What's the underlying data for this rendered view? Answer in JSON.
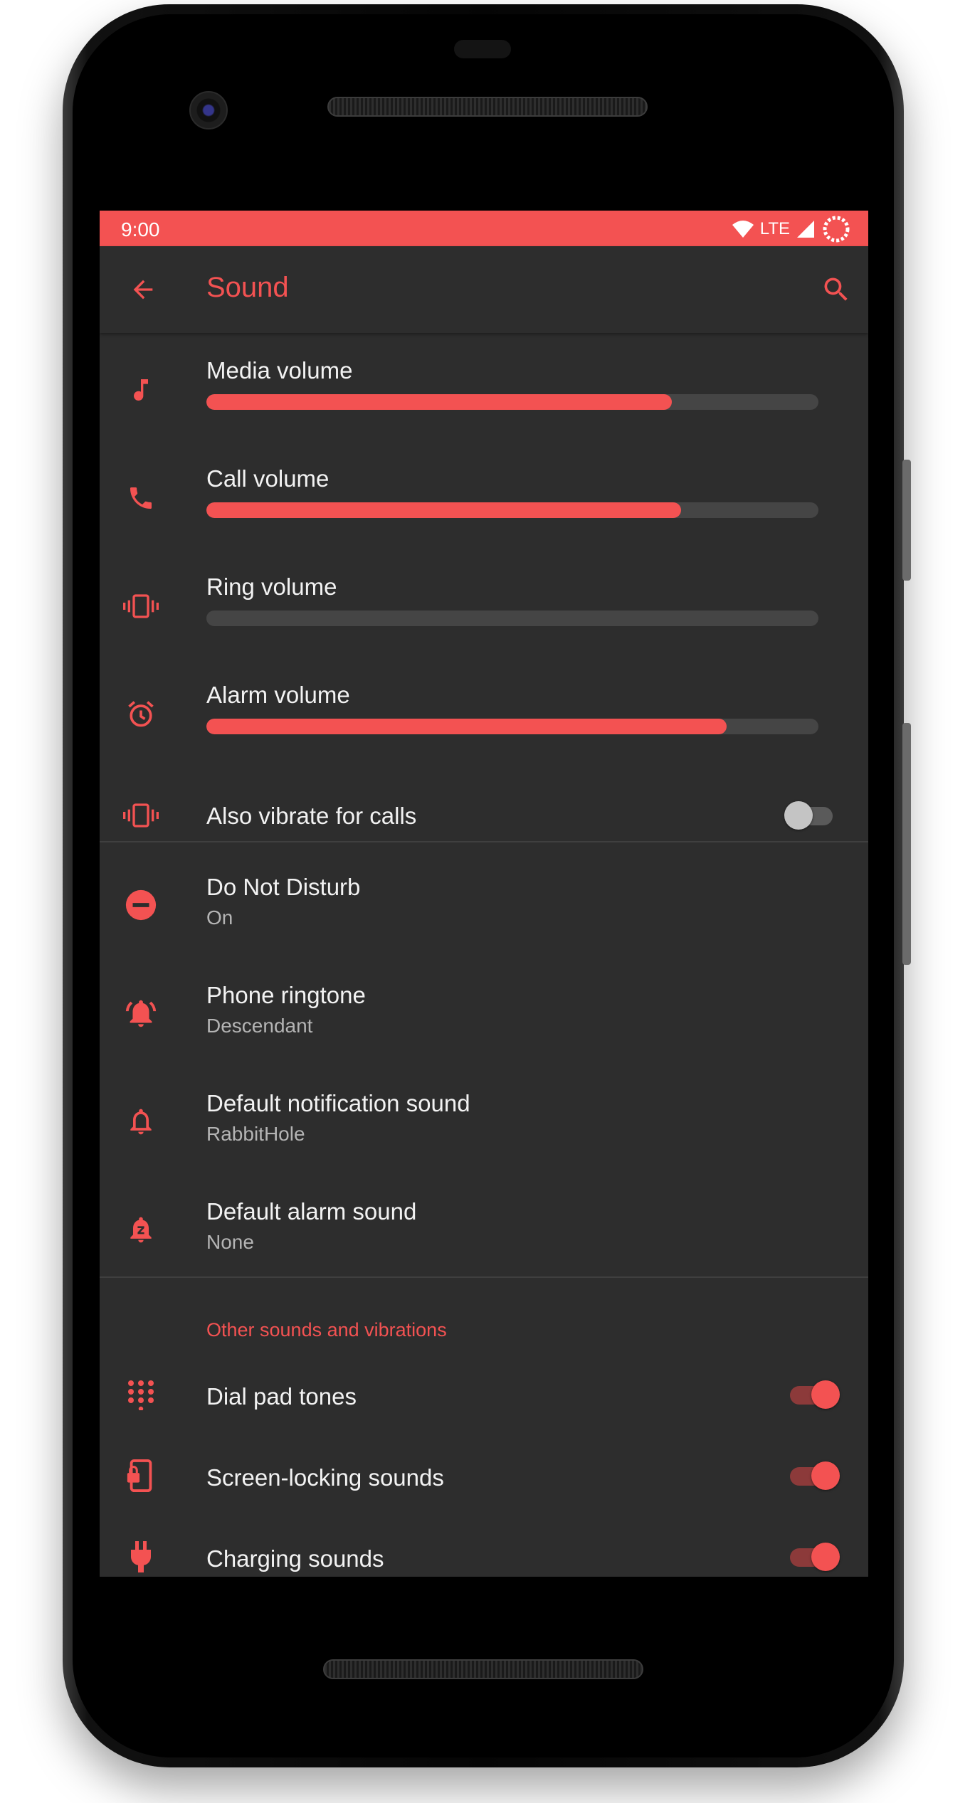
{
  "status_bar": {
    "time": "9:00",
    "network": "LTE"
  },
  "app_bar": {
    "title": "Sound"
  },
  "volume_sliders": [
    {
      "label": "Media volume",
      "level": 0.76,
      "icon": "music-note-icon"
    },
    {
      "label": "Call volume",
      "level": 0.775,
      "icon": "phone-icon"
    },
    {
      "label": "Ring volume",
      "level": 0.0,
      "icon": "vibrate-icon"
    },
    {
      "label": "Alarm volume",
      "level": 0.85,
      "icon": "alarm-clock-icon"
    }
  ],
  "vibrate_toggle": {
    "label": "Also vibrate for calls",
    "checked": false
  },
  "settings": [
    {
      "title": "Do Not Disturb",
      "summary": "On",
      "icon": "do-not-disturb-icon"
    },
    {
      "title": "Phone ringtone",
      "summary": "Descendant",
      "icon": "ringing-bell-icon"
    },
    {
      "title": "Default notification sound",
      "summary": "RabbitHole",
      "icon": "bell-icon"
    },
    {
      "title": "Default alarm sound",
      "summary": "None",
      "icon": "alarm-sleep-icon"
    }
  ],
  "other_section": {
    "header": "Other sounds and vibrations",
    "items": [
      {
        "label": "Dial pad tones",
        "checked": true,
        "icon": "dialpad-icon"
      },
      {
        "label": "Screen-locking sounds",
        "checked": true,
        "icon": "screen-lock-icon"
      },
      {
        "label": "Charging sounds",
        "checked": true,
        "icon": "charging-plug-icon"
      }
    ]
  },
  "colors": {
    "accent": "#f35252",
    "background": "#2d2d2d",
    "track": "#454545",
    "text": "#f2f2f2",
    "secondary_text": "#b4b4b4"
  }
}
